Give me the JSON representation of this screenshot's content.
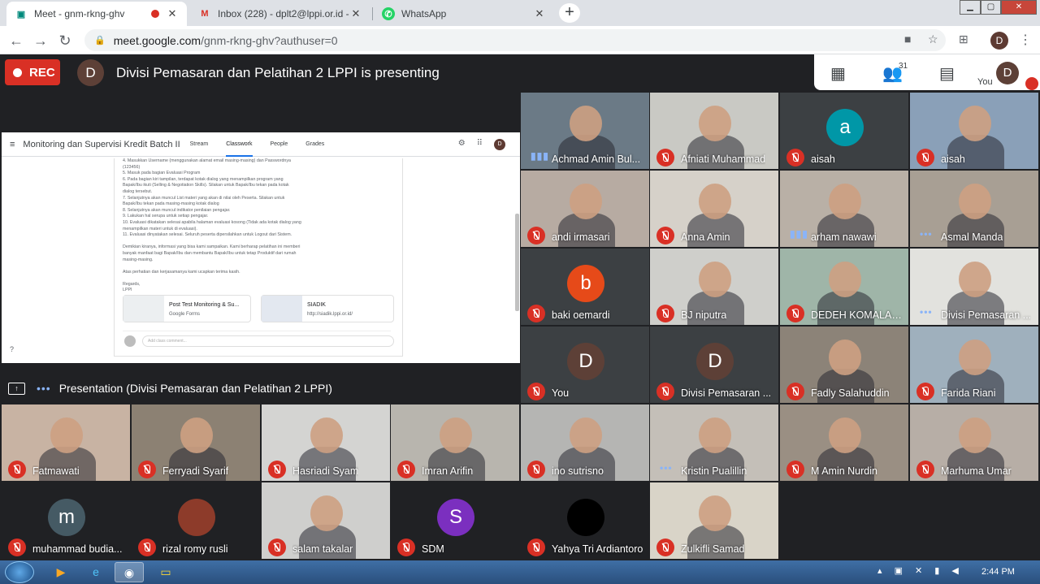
{
  "browser": {
    "tabs": [
      {
        "title": "Meet - gnm-rkng-ghv",
        "icon": "meet-icon",
        "recording": true
      },
      {
        "title": "Inbox (228) - dplt2@lppi.or.id - L",
        "icon": "gmail-icon"
      },
      {
        "title": "WhatsApp",
        "icon": "whatsapp-icon"
      }
    ],
    "new_tab": "+",
    "url_host": "meet.google.com",
    "url_path": "/gnm-rkng-ghv?authuser=0",
    "profile_initial": "D"
  },
  "meet": {
    "rec_label": "REC",
    "presenter_initial": "D",
    "presenting_text": "Divisi Pemasaran dan Pelatihan 2 LPPI is presenting",
    "participant_count": "31",
    "you_label": "You",
    "you_initial": "D",
    "presentation_label": "Presentation (Divisi Pemasaran dan Pelatihan 2 LPPI)"
  },
  "classroom": {
    "class_name": "Monitoring dan Supervisi Kredit Batch II",
    "tabs": [
      "Stream",
      "Classwork",
      "People",
      "Grades"
    ],
    "selected_tab": "Classwork",
    "avatar_initial": "D",
    "body_lines": [
      "4. Masukkan Username (menggunakan alamat email masing-masing) dan Passwordnya",
      "(123456)",
      "5. Masuk pada bagian Evaluasi Program",
      "6. Pada bagian kiri tampilan, terdapat kotak dialog yang menampilkan program yang",
      "Bapak/Ibu ikuti (Selling & Negotiation Skills). Silakan untuk Bapak/Ibu tekan pada kotak",
      "dialog tersebut.",
      "7. Selanjutnya akan muncul List materi yang akan di nilai oleh Peserta. Silakan untuk",
      "Bapak/Ibu tekan pada masing-masing kotak dialog",
      "8. Selanjutnya akan muncul indikator penilaian pengajar.",
      "9. Lakukan hal serupa untuk setiap pengajar.",
      "10. Evaluasi dikatakan selesai apabila halaman evaluasi kosong (Tidak ada kotak dialog yang",
      "menampilkan materi untuk di evaluasi).",
      "11. Evaluasi dinyatakan selesai. Seluruh peserta dipersilahkan untuk Logout dari Sistem.",
      "",
      "Demikian kiranya, informasi yang bisa kami sampaikan. Kami berharap pelatihan ini memberi",
      "banyak manfaat bagi Bapak/Ibu dan membantu Bapak/Ibu untuk tetap Produktif dari rumah",
      "masing-masing.",
      "",
      "Atas perhatian dan kerjasamanya kami ucapkan terima kasih.",
      "",
      "Regards,",
      "LPPI"
    ],
    "attachments": [
      {
        "title": "Post Test Monitoring & Su...",
        "sub": "Google Forms"
      },
      {
        "title": "SIADIK",
        "sub": "http://siadik.lppi.or.id/"
      }
    ],
    "comment_placeholder": "Add class comment..."
  },
  "participants": [
    {
      "name": "Achmad Amin Bul...",
      "status": "speaking",
      "kind": "video",
      "bg": "#6b7a86"
    },
    {
      "name": "Afniati Muhammad",
      "status": "muted",
      "kind": "video",
      "bg": "#c9c9c4"
    },
    {
      "name": "aisah",
      "status": "muted",
      "kind": "avatar",
      "initial": "a",
      "color": "#0097a7"
    },
    {
      "name": "aisah",
      "status": "muted",
      "kind": "video",
      "bg": "#8aa0b8"
    },
    {
      "name": "andi irmasari",
      "status": "muted",
      "kind": "video",
      "bg": "#b7aba2"
    },
    {
      "name": "Anna Amin",
      "status": "muted",
      "kind": "video",
      "bg": "#d6d1c9"
    },
    {
      "name": "arham nawawi",
      "status": "speaking",
      "kind": "video",
      "bg": "#b9b0a6"
    },
    {
      "name": "Asmal Manda",
      "status": "active",
      "kind": "video",
      "bg": "#a89f94"
    },
    {
      "name": "baki oemardi",
      "status": "muted",
      "kind": "avatar",
      "initial": "b",
      "color": "#e64a19"
    },
    {
      "name": "BJ niputra",
      "status": "muted",
      "kind": "video",
      "bg": "#cfcfcb"
    },
    {
      "name": "DEDEH KOMALAS...",
      "status": "muted",
      "kind": "video",
      "bg": "#9fb5a8"
    },
    {
      "name": "Divisi Pemasaran ...",
      "status": "active",
      "kind": "video",
      "bg": "#e2e2de"
    },
    {
      "name": "You",
      "status": "muted",
      "kind": "avatar",
      "initial": "D",
      "color": "#5d4037"
    },
    {
      "name": "Divisi Pemasaran ...",
      "status": "muted",
      "kind": "avatar",
      "initial": "D",
      "color": "#5d4037"
    },
    {
      "name": "Fadly Salahuddin",
      "status": "muted",
      "kind": "video",
      "bg": "#8c8378"
    },
    {
      "name": "Farida Riani",
      "status": "muted",
      "kind": "video",
      "bg": "#9fb0bd"
    },
    {
      "name": "Fatmawati",
      "status": "muted",
      "kind": "video",
      "bg": "#c8b3a3"
    },
    {
      "name": "Ferryadi Syarif",
      "status": "muted",
      "kind": "video",
      "bg": "#8c8173"
    },
    {
      "name": "Hasriadi Syam",
      "status": "muted",
      "kind": "video",
      "bg": "#d4d4d2"
    },
    {
      "name": "Imran Arifin",
      "status": "muted",
      "kind": "video",
      "bg": "#b8b5ae"
    },
    {
      "name": "ino sutrisno",
      "status": "muted",
      "kind": "video",
      "bg": "#b5b5b3"
    },
    {
      "name": "Kristin Pualillin",
      "status": "active",
      "kind": "video",
      "bg": "#c4bfb8"
    },
    {
      "name": "M Amin Nurdin",
      "status": "muted",
      "kind": "video",
      "bg": "#9a8f83"
    },
    {
      "name": "Marhuma Umar",
      "status": "muted",
      "kind": "video",
      "bg": "#b7aea6"
    },
    {
      "name": "muhammad budia...",
      "status": "muted",
      "kind": "avatar",
      "initial": "m",
      "color": "#455a64"
    },
    {
      "name": "rizal romy rusli",
      "status": "muted",
      "kind": "avatar",
      "initial": "",
      "color": "#8d3b2a"
    },
    {
      "name": "salam takalar",
      "status": "muted",
      "kind": "video",
      "bg": "#cfcfcd"
    },
    {
      "name": "SDM",
      "status": "muted",
      "kind": "avatar",
      "initial": "S",
      "color": "#7b2fbf"
    },
    {
      "name": "Yahya Tri Ardiantoro",
      "status": "muted",
      "kind": "avatar",
      "initial": "",
      "color": "#000000"
    },
    {
      "name": "Zulkifli Samad",
      "status": "muted",
      "kind": "video",
      "bg": "#d9d4c8"
    }
  ],
  "taskbar": {
    "clock": "2:44 PM",
    "apps": [
      "media-player-icon",
      "ie-icon",
      "chrome-icon",
      "folder-icon"
    ]
  }
}
